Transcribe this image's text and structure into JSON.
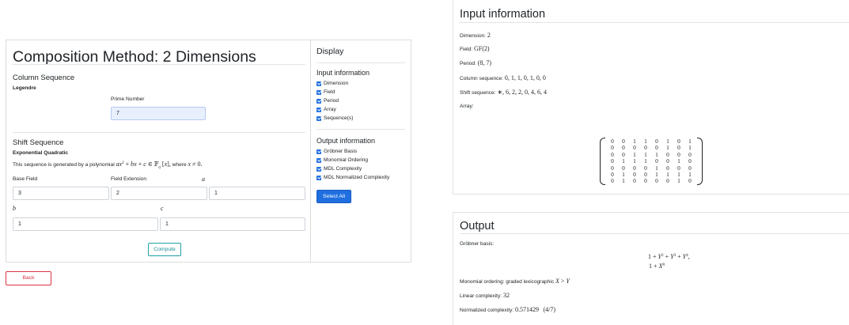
{
  "main": {
    "title": "Composition Method: 2 Dimensions",
    "column_sequence": {
      "heading": "Column Sequence",
      "type": "Legendre",
      "prime_label": "Prime Number",
      "prime_value": "7"
    },
    "shift_sequence": {
      "heading": "Shift Sequence",
      "type": "Exponential Quadratic",
      "description_prefix": "This sequence is generated by a polynomial",
      "description_suffix": "where",
      "base_field_label": "Base Field",
      "base_field_value": "3",
      "field_extension_label": "Field Extension",
      "field_extension_value": "2",
      "a_label": "a",
      "a_value": "1",
      "b_label": "b",
      "b_value": "1",
      "c_label": "c",
      "c_value": "1"
    },
    "compute_label": "Compute"
  },
  "back_label": "Back",
  "display": {
    "title": "Display",
    "input_heading": "Input information",
    "input_items": [
      "Dimension",
      "Field",
      "Period",
      "Array",
      "Sequence(s)"
    ],
    "output_heading": "Output information",
    "output_items": [
      "Gröbner Basis",
      "Monomial Ordering",
      "MDL Complexity",
      "MDL Normalized Complexity"
    ],
    "select_all_label": "Select All"
  },
  "input_info": {
    "title": "Input information",
    "dimension_label": "Dimension:",
    "dimension_value": "2",
    "field_label": "Field:",
    "field_value": "GF(2)",
    "period_label": "Period:",
    "period_value": "(8, 7)",
    "column_seq_label": "Column sequence:",
    "column_seq_value": "0, 1, 1, 0, 1, 0, 0",
    "shift_seq_label": "Shift sequence:",
    "shift_seq_value": "∗, 6, 2, 2, 0, 4, 6, 4",
    "array_label": "Array:",
    "array": [
      [
        0,
        0,
        1,
        1,
        0,
        1,
        0,
        1
      ],
      [
        0,
        0,
        0,
        0,
        0,
        1,
        0,
        1
      ],
      [
        0,
        0,
        1,
        1,
        1,
        0,
        0,
        0
      ],
      [
        0,
        1,
        1,
        1,
        0,
        0,
        1,
        0
      ],
      [
        0,
        0,
        0,
        0,
        1,
        0,
        0,
        0
      ],
      [
        0,
        1,
        0,
        0,
        1,
        1,
        1,
        1
      ],
      [
        0,
        1,
        0,
        0,
        0,
        0,
        1,
        0
      ]
    ]
  },
  "output_info": {
    "title": "Output",
    "grobner_label": "Gröbner basis:",
    "monomial_label": "Monomial ordering: graded lexicographic",
    "linear_label": "Linear complexity:",
    "linear_value": "32",
    "normalized_label": "Normalized complexity:",
    "normalized_value": "0.571429",
    "normalized_fraction": "(4/7)"
  }
}
